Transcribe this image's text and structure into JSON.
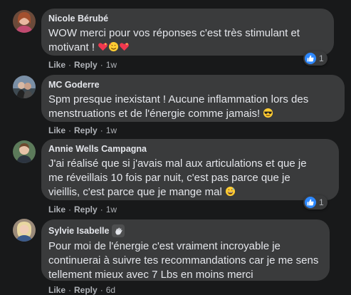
{
  "comments": [
    {
      "name": "Nicole Bérubé",
      "text": "WOW merci pour vos réponses c'est très stimulant et\nmotivant !",
      "emojis": [
        "sparkling-heart-emoji",
        "smiling-face-with-hearts-emoji",
        "sparkling-heart-emoji"
      ],
      "like": "Like",
      "reply": "Reply",
      "time": "1w",
      "reaction_icon": "thumbs-up-icon",
      "reaction_count": "1"
    },
    {
      "name": "MC Goderre",
      "text": "Spm presque inexistant ! Aucune inflammation lors des\nmenstruations et de l'énergie comme jamais!",
      "emojis": [
        "smiling-face-with-sunglasses-emoji"
      ],
      "like": "Like",
      "reply": "Reply",
      "time": "1w"
    },
    {
      "name": "Annie Wells Campagna",
      "text": "J'ai réalisé que si j'avais mal aux articulations et que je\nme réveillais 10 fois par nuit, c'est pas parce que je\nvieillis, c'est parce que je mange mal",
      "emojis": [
        "grinning-face-with-sweat-emoji"
      ],
      "like": "Like",
      "reply": "Reply",
      "time": "1w",
      "reaction_icon": "thumbs-up-icon",
      "reaction_count": "1"
    },
    {
      "name": "Sylvie Isabelle",
      "badge_icon": "waving-hand-icon",
      "text": "Pour moi de l'énergie c'est vraiment incroyable je\ncontinuerai à suivre tes recommandations car je me sens\ntellement mieux avec 7 Lbs en moins merci",
      "like": "Like",
      "reply": "Reply",
      "time": "6d"
    }
  ],
  "separator": "·",
  "colors": {
    "background": "#18191a",
    "bubble": "#3a3b3c",
    "text": "#e4e6eb",
    "secondary_text": "#b0b3b8",
    "like_blue": "#2d88ff"
  }
}
